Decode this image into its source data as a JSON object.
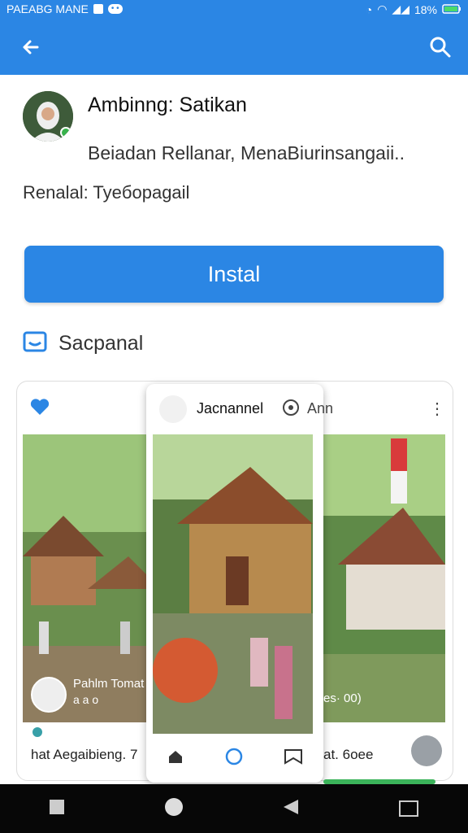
{
  "status_bar": {
    "left_text": "PAEABG MANE",
    "right_text": "18%"
  },
  "app": {
    "title": "Ambinng: Satikan",
    "subtitle": "Beiadan Rellanar, MenaBiurinsangaii..",
    "meta": "Renalal: Tyeбopagail",
    "install_label": "Instal"
  },
  "section": {
    "label": "Sacpanal"
  },
  "overlay": {
    "name": "Jacnannel",
    "ann": "Ann"
  },
  "left_video": {
    "title": "Pahlm Tomat",
    "sub": "a a o"
  },
  "right_video": {
    "text": "es· 00)"
  },
  "captions": {
    "left": "hat Aegaibieng. 7",
    "right": "at. 6oee"
  },
  "colors": {
    "accent": "#2b86e4",
    "success": "#38b24c"
  },
  "icons": {
    "back": "arrow-left-icon",
    "search": "search-icon",
    "heart": "heart-icon"
  }
}
